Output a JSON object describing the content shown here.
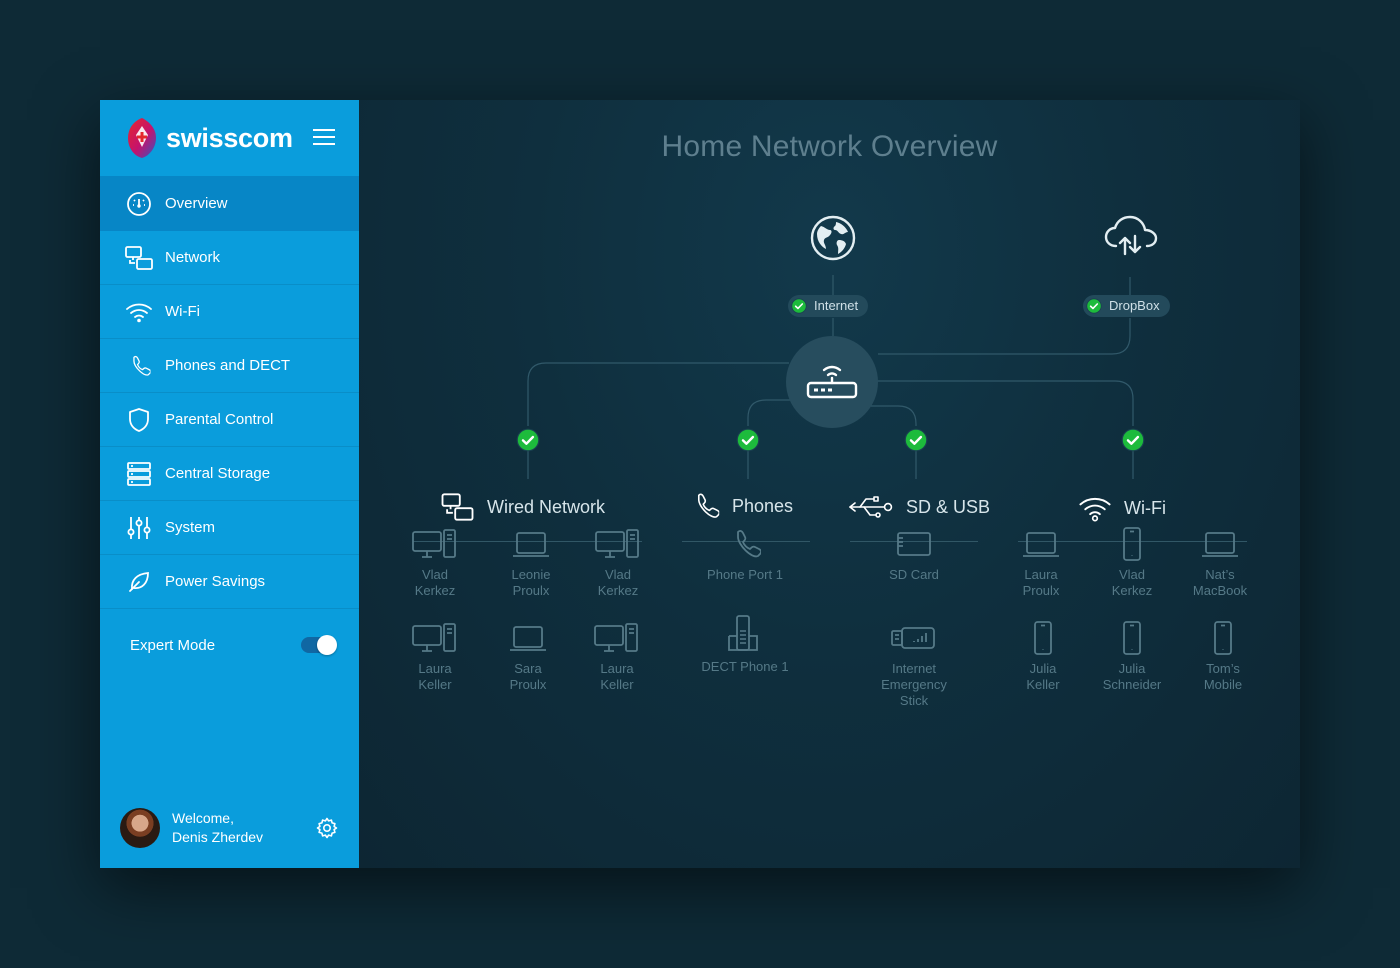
{
  "brand": {
    "name": "swisscom"
  },
  "sidebar": {
    "items": [
      {
        "label": "Overview",
        "icon": "dashboard-icon"
      },
      {
        "label": "Network",
        "icon": "network-icon"
      },
      {
        "label": "Wi-Fi",
        "icon": "wifi-icon"
      },
      {
        "label": "Phones and DECT",
        "icon": "phone-icon"
      },
      {
        "label": "Parental Control",
        "icon": "shield-icon"
      },
      {
        "label": "Central Storage",
        "icon": "storage-icon"
      },
      {
        "label": "System",
        "icon": "sliders-icon"
      },
      {
        "label": "Power Savings",
        "icon": "leaf-icon"
      }
    ],
    "expert_mode": {
      "label": "Expert Mode",
      "enabled": true
    },
    "user": {
      "greeting": "Welcome,",
      "name": "Denis Zherdev"
    }
  },
  "main": {
    "title": "Home Network Overview",
    "services": {
      "internet": "Internet",
      "dropbox": "DropBox"
    },
    "categories": {
      "wired": "Wired Network",
      "phones": "Phones",
      "sdusb": "SD & USB",
      "wifi": "Wi-Fi"
    },
    "devices": {
      "wired": [
        {
          "line1": "Vlad",
          "line2": "Kerkez",
          "icon": "desktop-icon"
        },
        {
          "line1": "Leonie",
          "line2": "Proulx",
          "icon": "laptop-icon"
        },
        {
          "line1": "Vlad",
          "line2": "Kerkez",
          "icon": "desktop-icon"
        },
        {
          "line1": "Laura",
          "line2": "Keller",
          "icon": "desktop-icon"
        },
        {
          "line1": "Sara",
          "line2": "Proulx",
          "icon": "laptop-icon"
        },
        {
          "line1": "Laura",
          "line2": "Keller",
          "icon": "desktop-icon"
        }
      ],
      "phones": [
        {
          "line1": "Phone Port 1",
          "line2": "",
          "icon": "phone-icon"
        },
        {
          "line1": "DECT Phone 1",
          "line2": "",
          "icon": "dect-phone-icon"
        }
      ],
      "sdusb": [
        {
          "line1": "SD Card",
          "line2": "",
          "icon": "sd-card-icon"
        },
        {
          "line1": "Internet",
          "line2": "Emergency Stick",
          "icon": "usb-stick-icon"
        }
      ],
      "wifi": [
        {
          "line1": "Laura",
          "line2": "Proulx",
          "icon": "laptop-icon"
        },
        {
          "line1": "Vlad",
          "line2": "Kerkez",
          "icon": "smartphone-icon"
        },
        {
          "line1": "Nat’s",
          "line2": "MacBook",
          "icon": "laptop-icon"
        },
        {
          "line1": "Julia",
          "line2": "Keller",
          "icon": "smartphone-icon"
        },
        {
          "line1": "Julia",
          "line2": "Schneider",
          "icon": "smartphone-icon"
        },
        {
          "line1": "Tom’s",
          "line2": "Mobile",
          "icon": "smartphone-icon"
        }
      ]
    }
  },
  "colors": {
    "sidebar": "#0a9ddc",
    "sidebar_active": "#0786c6",
    "background": "#0e2a36",
    "status_ok": "#1dbb3c"
  }
}
